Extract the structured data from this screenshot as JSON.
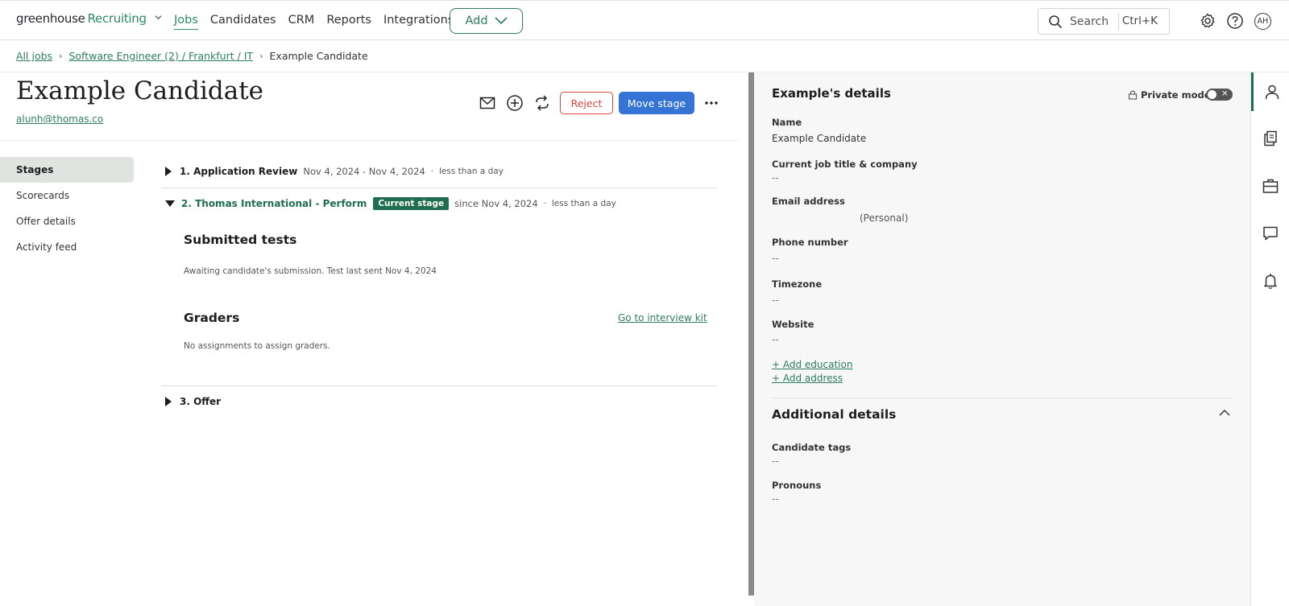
{
  "nav": {
    "logo_main": "greenhouse",
    "logo_product": "Recruiting",
    "links": [
      "Jobs",
      "Candidates",
      "CRM",
      "Reports",
      "Integrations"
    ],
    "add_label": "Add",
    "search_label": "Search",
    "search_shortcut": "Ctrl+K",
    "avatar_initials": "AH"
  },
  "breadcrumb": {
    "all_jobs": "All jobs",
    "job": "Software Engineer (2) / Frankfurt / IT",
    "current": "Example Candidate"
  },
  "candidate": {
    "name": "Example Candidate",
    "email": "alunh@thomas.co",
    "reject_label": "Reject",
    "move_label": "Move stage"
  },
  "side_menu": [
    "Stages",
    "Scorecards",
    "Offer details",
    "Activity feed"
  ],
  "stages": [
    {
      "title": "1. Application Review",
      "dates": "Nov 4, 2024 - Nov 4, 2024",
      "duration": "less than a day"
    },
    {
      "title": "2. Thomas International - Perform",
      "badge": "Current stage",
      "dates": "since Nov 4, 2024",
      "duration": "less than a day"
    },
    {
      "title": "3. Offer"
    }
  ],
  "stage_detail": {
    "submitted_title": "Submitted tests",
    "submitted_text": "Awaiting candidate's submission. Test last sent Nov 4, 2024",
    "graders_title": "Graders",
    "graders_link": "Go to interview kit",
    "graders_text": "No assignments to assign graders."
  },
  "details": {
    "title": "Example's details",
    "private_mode": "Private mode",
    "name_label": "Name",
    "name_value": "Example Candidate",
    "job_label": "Current job title & company",
    "job_value": "--",
    "email_label": "Email address",
    "email_value": "(Personal)",
    "phone_label": "Phone number",
    "phone_value": "--",
    "timezone_label": "Timezone",
    "timezone_value": "--",
    "website_label": "Website",
    "website_value": "--",
    "add_education": "+ Add education",
    "add_address": "+ Add address"
  },
  "additional": {
    "title": "Additional details",
    "tags_label": "Candidate tags",
    "tags_value": "--",
    "pronouns_label": "Pronouns",
    "pronouns_value": "--"
  },
  "colors": {
    "brand_green": "#2e8b68",
    "dark_green": "#1f6e4f",
    "reject_red": "#d9483b",
    "primary_blue": "#3574d4"
  }
}
